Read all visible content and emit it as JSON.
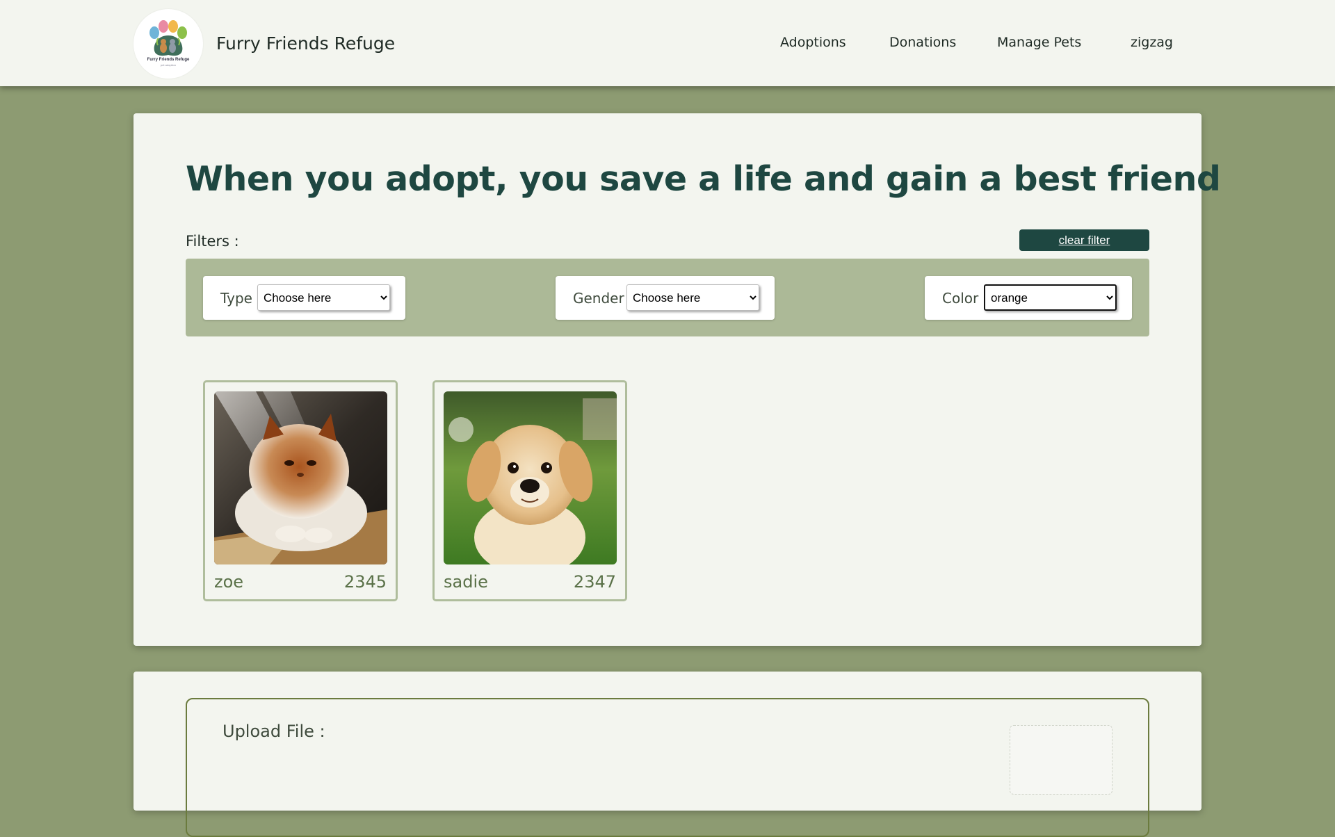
{
  "header": {
    "brand": "Furry Friends Refuge",
    "logo_text": "Furry Friends Refuge",
    "logo_subtext": "pet adoption",
    "nav": [
      {
        "label": "Adoptions"
      },
      {
        "label": "Donations"
      },
      {
        "label": "Manage Pets"
      },
      {
        "label": "zigzag"
      }
    ]
  },
  "main": {
    "headline": "When you adopt, you save a life and gain a best friend",
    "filters_label": "Filters :",
    "clear_filter_label": "clear filter",
    "filters": [
      {
        "label": "Type",
        "value": "Choose here"
      },
      {
        "label": "Gender",
        "value": "Choose here"
      },
      {
        "label": "Color",
        "value": "orange"
      }
    ],
    "pets": [
      {
        "name": "zoe",
        "id": "2345",
        "photo": "persian-cat-photo"
      },
      {
        "name": "sadie",
        "id": "2347",
        "photo": "golden-retriever-puppy-photo"
      }
    ]
  },
  "upload": {
    "label": "Upload File :"
  },
  "colors": {
    "page_bg": "#8d9b72",
    "card_bg": "#f3f5ef",
    "accent_dark_teal": "#1e4741",
    "filter_bar": "#acb997",
    "pet_text": "#5a7148"
  }
}
